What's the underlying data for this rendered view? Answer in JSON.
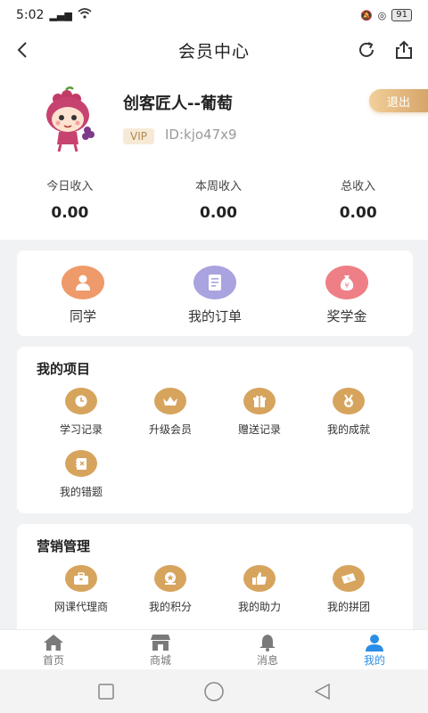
{
  "status": {
    "time": "5:02",
    "battery": "91"
  },
  "header": {
    "title": "会员中心"
  },
  "profile": {
    "name": "创客匠人--葡萄",
    "vip": "VIP",
    "id": "ID:kjo47x9",
    "logout": "退出"
  },
  "income": [
    {
      "label": "今日收入",
      "value": "0.00"
    },
    {
      "label": "本周收入",
      "value": "0.00"
    },
    {
      "label": "总收入",
      "value": "0.00"
    }
  ],
  "quick": [
    {
      "label": "同学",
      "icon": "user-icon",
      "color": "#ef9a6a"
    },
    {
      "label": "我的订单",
      "icon": "order-icon",
      "color": "#a9a3e0"
    },
    {
      "label": "奖学金",
      "icon": "money-bag-icon",
      "color": "#ee7f86"
    }
  ],
  "projects": {
    "title": "我的项目",
    "items": [
      {
        "label": "学习记录",
        "icon": "clock-icon"
      },
      {
        "label": "升级会员",
        "icon": "crown-icon"
      },
      {
        "label": "赠送记录",
        "icon": "gift-icon"
      },
      {
        "label": "我的成就",
        "icon": "medal-icon"
      },
      {
        "label": "我的错题",
        "icon": "notebook-icon"
      }
    ]
  },
  "marketing": {
    "title": "营销管理",
    "items": [
      {
        "label": "网课代理商",
        "icon": "briefcase-icon"
      },
      {
        "label": "我的积分",
        "icon": "points-icon"
      },
      {
        "label": "我的助力",
        "icon": "thumbs-up-icon"
      },
      {
        "label": "我的拼团",
        "icon": "coupon-icon"
      }
    ]
  },
  "tabs": [
    {
      "label": "首页",
      "icon": "home-icon"
    },
    {
      "label": "商城",
      "icon": "shop-icon"
    },
    {
      "label": "消息",
      "icon": "bell-icon"
    },
    {
      "label": "我的",
      "icon": "person-icon",
      "active": true
    }
  ],
  "colors": {
    "accent": "#2a8de8",
    "gold": "#d7a45e"
  }
}
